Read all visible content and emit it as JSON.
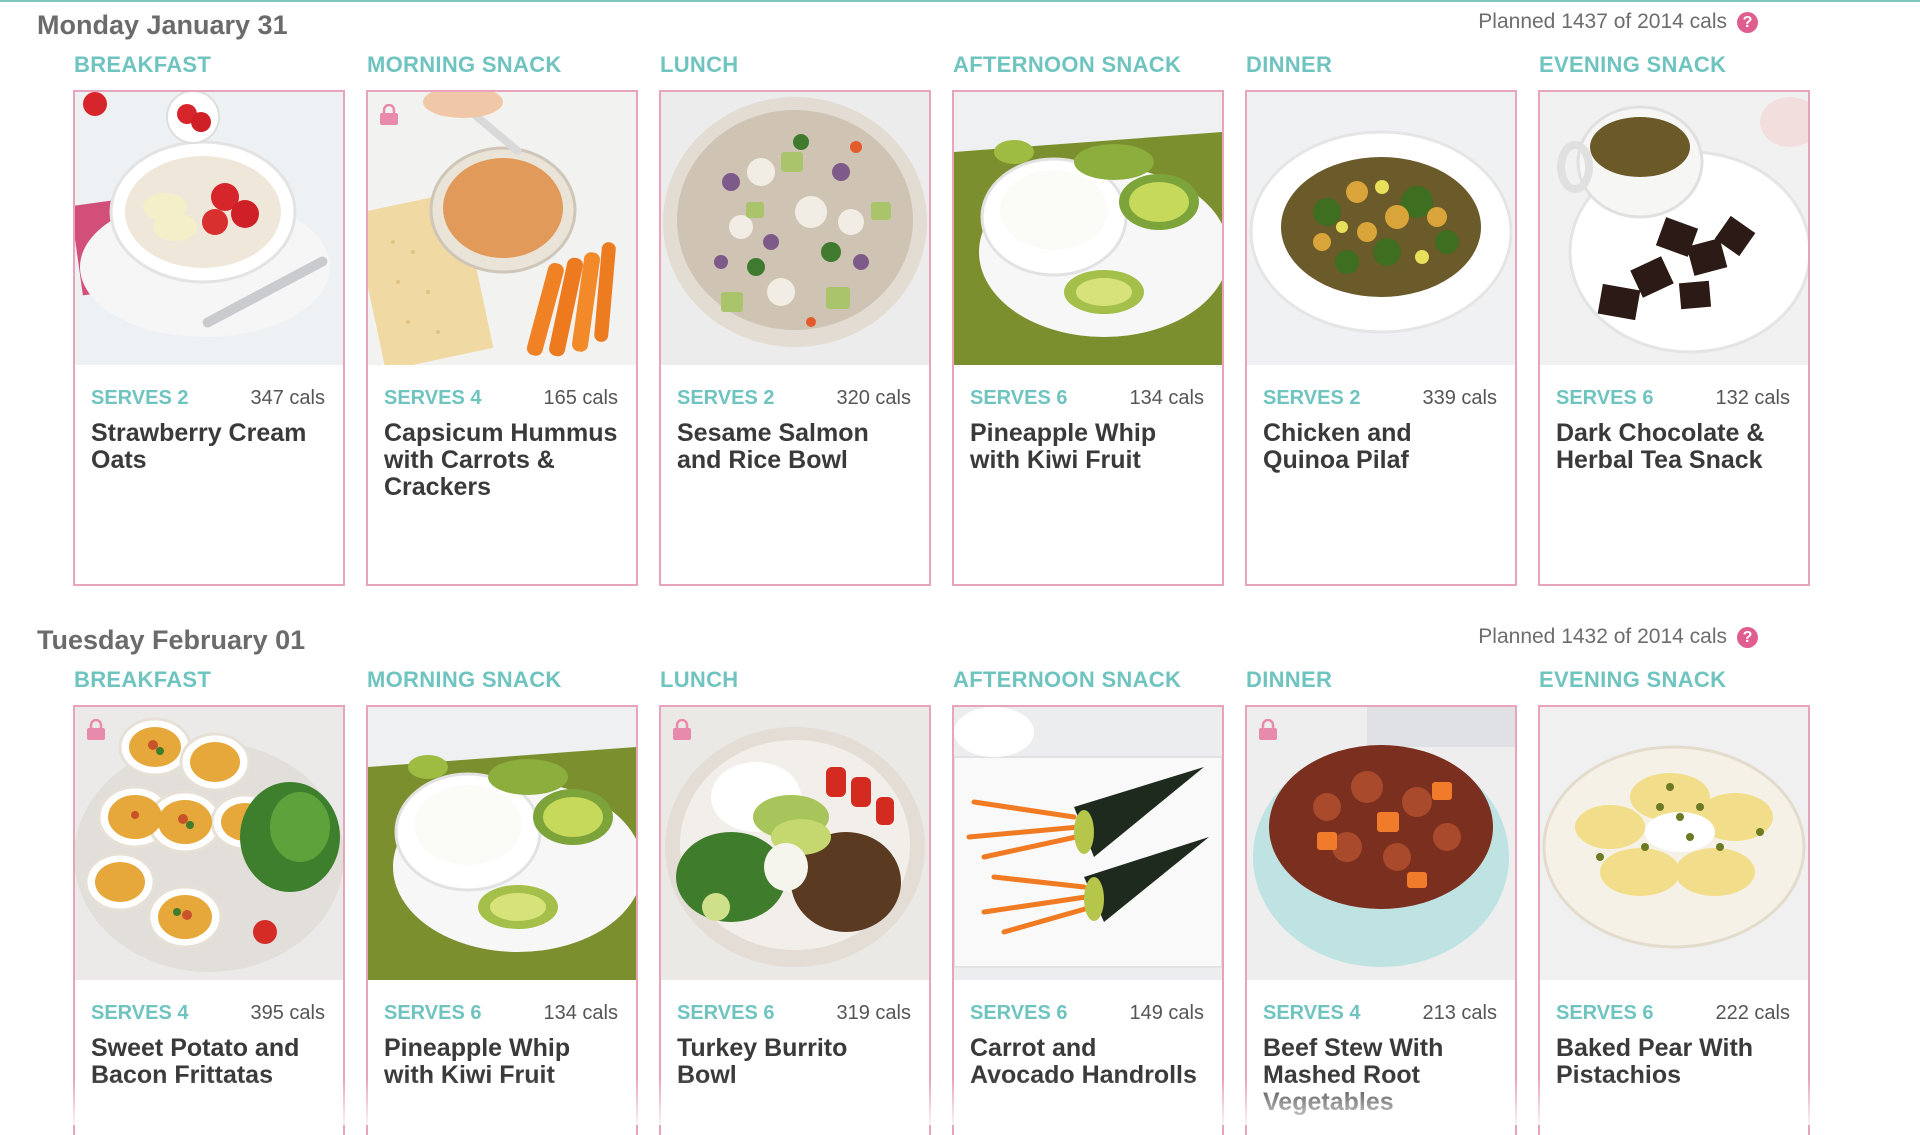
{
  "colors": {
    "accent_teal": "#6fc4c0",
    "card_border": "#e8a4bd",
    "help_pink": "#e05e8f",
    "lock_pink": "#e88aab"
  },
  "days": [
    {
      "title": "Monday January 31",
      "planned": "Planned 1437 of 2014 cals",
      "meals": [
        {
          "label": "BREAKFAST",
          "serves": "SERVES 2",
          "cals": "347 cals",
          "name": "Strawberry Cream Oats",
          "photo": "strawberry-cream-oats-photo",
          "locked": false
        },
        {
          "label": "MORNING SNACK",
          "serves": "SERVES 4",
          "cals": "165 cals",
          "name": "Capsicum Hummus with Carrots & Crackers",
          "photo": "capsicum-hummus-photo",
          "locked": true
        },
        {
          "label": "LUNCH",
          "serves": "SERVES 2",
          "cals": "320 cals",
          "name": "Sesame Salmon and Rice Bowl",
          "photo": "sesame-salmon-bowl-photo",
          "locked": false
        },
        {
          "label": "AFTERNOON SNACK",
          "serves": "SERVES 6",
          "cals": "134 cals",
          "name": "Pineapple Whip with Kiwi Fruit",
          "photo": "pineapple-whip-kiwi-photo",
          "locked": false
        },
        {
          "label": "DINNER",
          "serves": "SERVES 2",
          "cals": "339 cals",
          "name": "Chicken and Quinoa Pilaf",
          "photo": "chicken-quinoa-pilaf-photo",
          "locked": false
        },
        {
          "label": "EVENING SNACK",
          "serves": "SERVES 6",
          "cals": "132 cals",
          "name": "Dark Chocolate & Herbal Tea Snack",
          "photo": "dark-chocolate-tea-photo",
          "locked": false
        }
      ]
    },
    {
      "title": "Tuesday February 01",
      "planned": "Planned 1432 of 2014 cals",
      "meals": [
        {
          "label": "BREAKFAST",
          "serves": "SERVES 4",
          "cals": "395 cals",
          "name": "Sweet Potato and Bacon Frittatas",
          "photo": "sweet-potato-frittatas-photo",
          "locked": true
        },
        {
          "label": "MORNING SNACK",
          "serves": "SERVES 6",
          "cals": "134 cals",
          "name": "Pineapple Whip with Kiwi Fruit",
          "photo": "pineapple-whip-kiwi-photo",
          "locked": false
        },
        {
          "label": "LUNCH",
          "serves": "SERVES 6",
          "cals": "319 cals",
          "name": "Turkey Burrito Bowl",
          "photo": "turkey-burrito-bowl-photo",
          "locked": true
        },
        {
          "label": "AFTERNOON SNACK",
          "serves": "SERVES 6",
          "cals": "149 cals",
          "name": "Carrot and Avocado Handrolls",
          "photo": "carrot-avocado-handrolls-photo",
          "locked": false
        },
        {
          "label": "DINNER",
          "serves": "SERVES 4",
          "cals": "213 cals",
          "name": "Beef Stew With Mashed Root Vegetables",
          "photo": "beef-stew-photo",
          "locked": true
        },
        {
          "label": "EVENING SNACK",
          "serves": "SERVES 6",
          "cals": "222 cals",
          "name": "Baked Pear With Pistachios",
          "photo": "baked-pear-pistachios-photo",
          "locked": false
        }
      ]
    }
  ]
}
